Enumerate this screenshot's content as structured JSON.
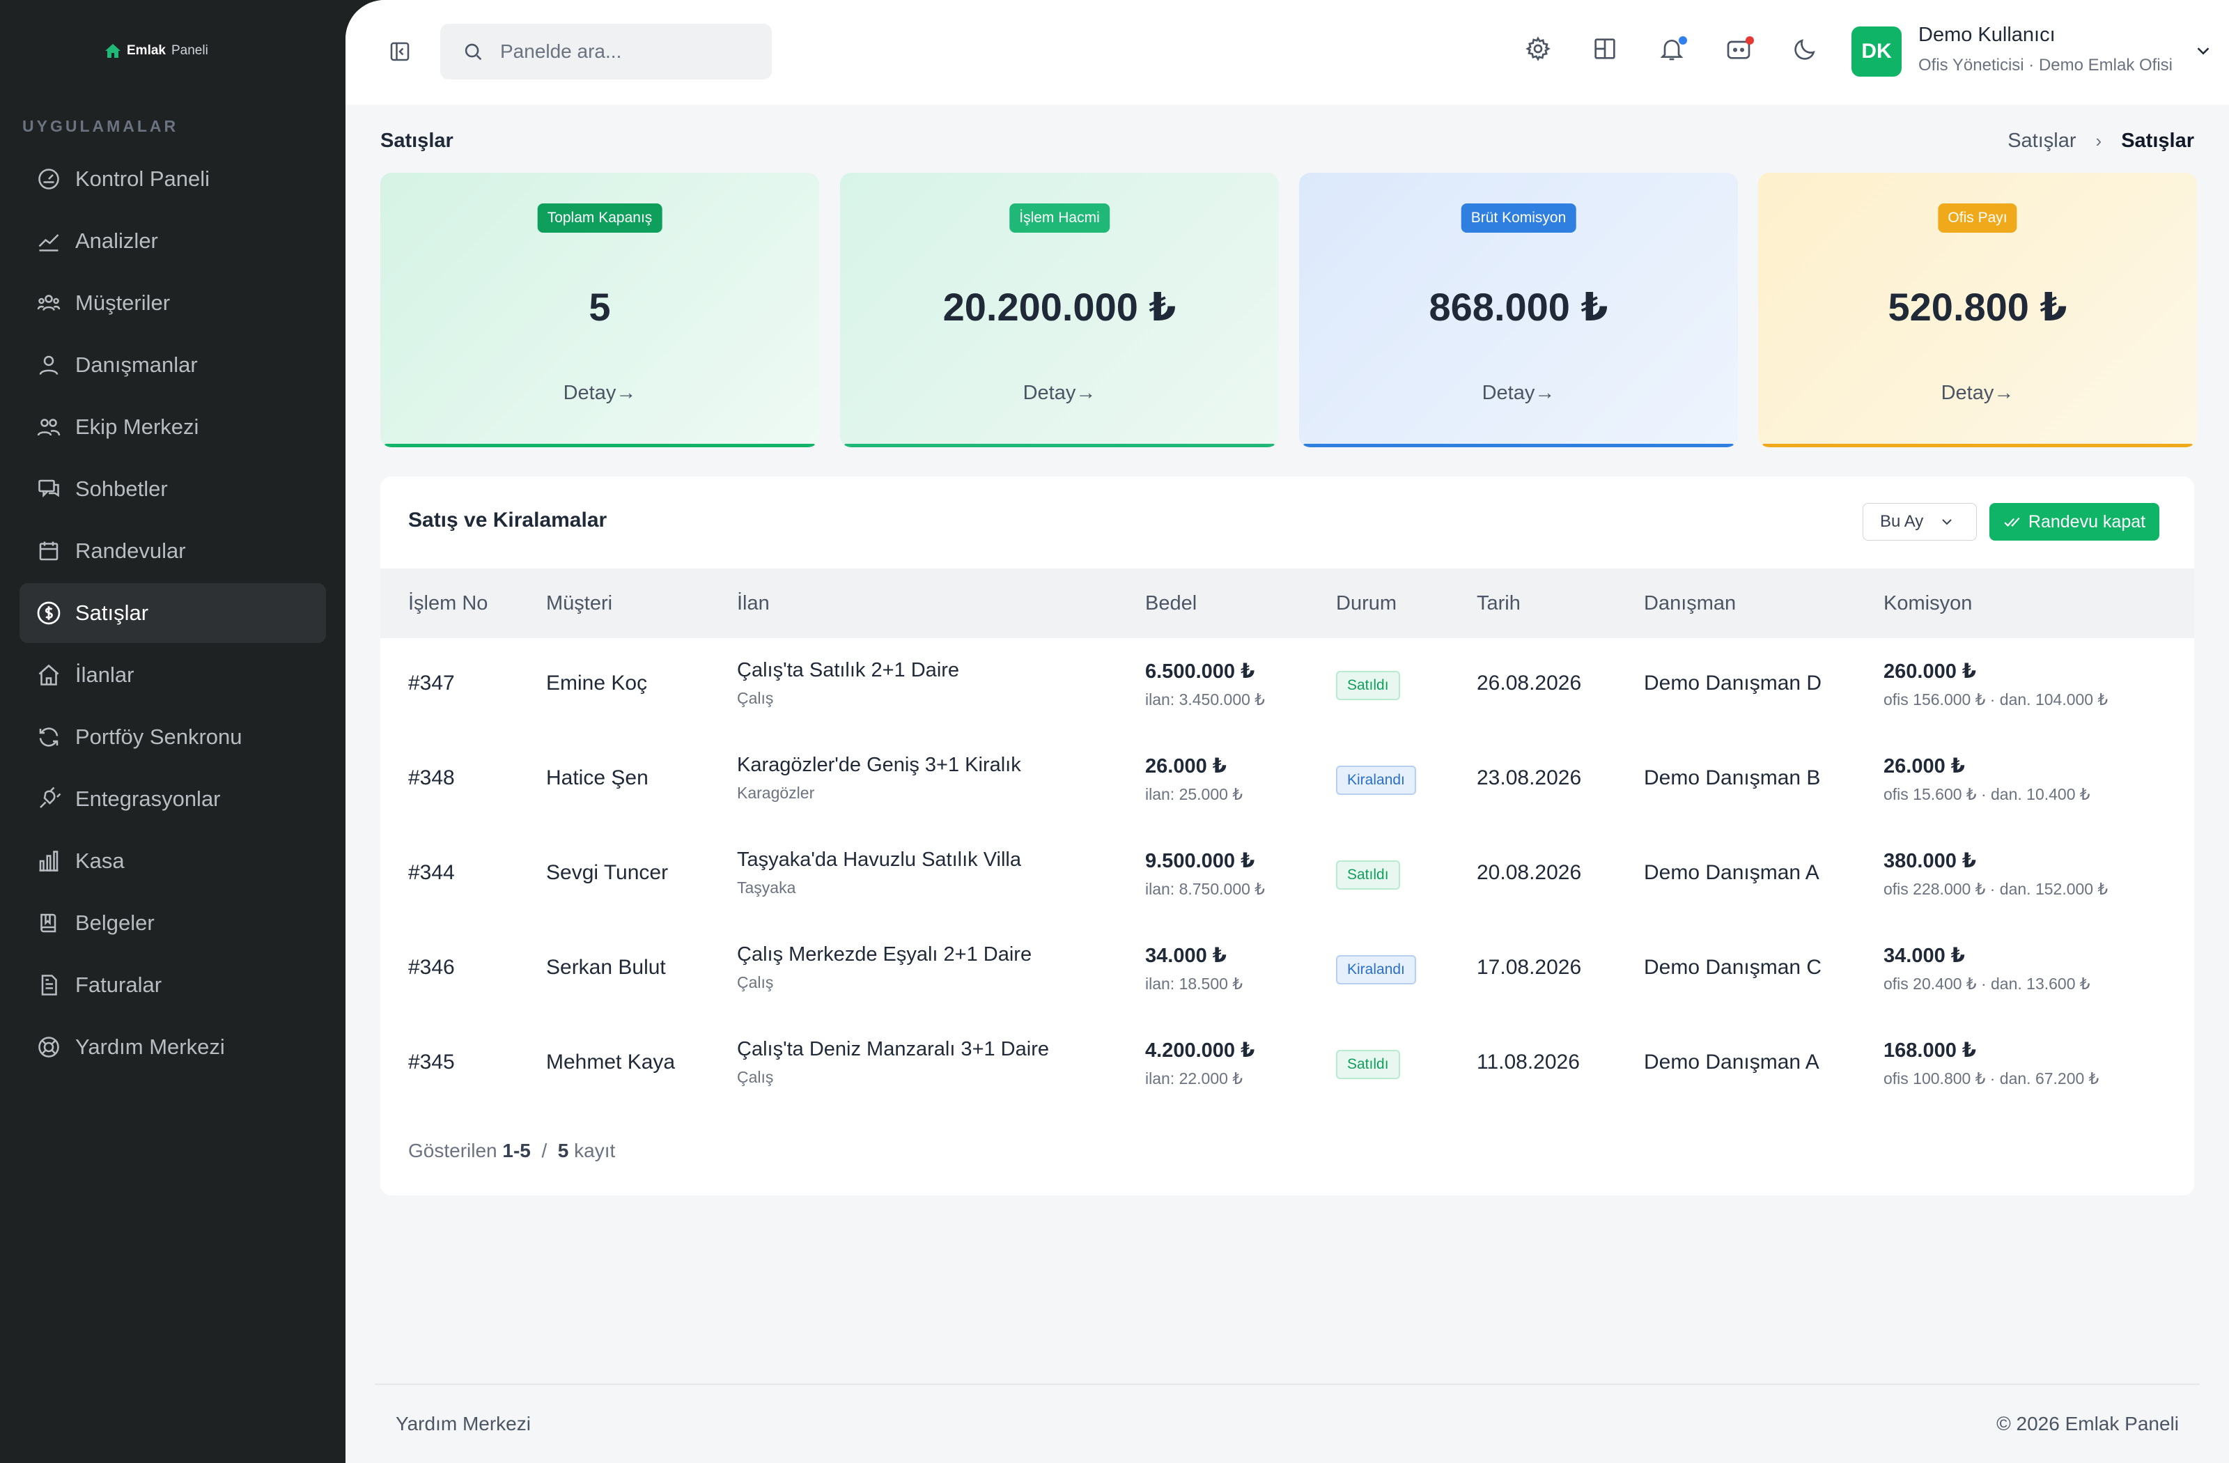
{
  "brand": {
    "name": "Emlak",
    "suffix": "Paneli"
  },
  "sidebar": {
    "section_title": "UYGULAMALAR",
    "items": [
      {
        "label": "Kontrol Paneli",
        "icon": "dashboard-icon"
      },
      {
        "label": "Analizler",
        "icon": "chart-line-icon"
      },
      {
        "label": "Müşteriler",
        "icon": "users-icon"
      },
      {
        "label": "Danışmanlar",
        "icon": "user-icon"
      },
      {
        "label": "Ekip Merkezi",
        "icon": "team-icon"
      },
      {
        "label": "Sohbetler",
        "icon": "chat-icon"
      },
      {
        "label": "Randevular",
        "icon": "calendar-icon"
      },
      {
        "label": "Satışlar",
        "icon": "dollar-icon",
        "active": true
      },
      {
        "label": "İlanlar",
        "icon": "home-icon"
      },
      {
        "label": "Portföy Senkronu",
        "icon": "sync-icon"
      },
      {
        "label": "Entegrasyonlar",
        "icon": "plug-icon"
      },
      {
        "label": "Kasa",
        "icon": "bar-chart-icon"
      },
      {
        "label": "Belgeler",
        "icon": "book-icon"
      },
      {
        "label": "Faturalar",
        "icon": "invoice-icon"
      },
      {
        "label": "Yardım Merkezi",
        "icon": "help-icon"
      }
    ]
  },
  "topbar": {
    "search_placeholder": "Panelde ara...",
    "user": {
      "initials": "DK",
      "name": "Demo Kullanıcı",
      "role": "Ofis Yöneticisi · Demo Emlak Ofisi"
    },
    "notification_dot_color": "#2f80ed",
    "message_dot_color": "#e53935"
  },
  "page": {
    "title": "Satışlar",
    "breadcrumb": {
      "parent": "Satışlar",
      "separator": "›",
      "current": "Satışlar"
    }
  },
  "stats": [
    {
      "badge": "Toplam Kapanış",
      "value": "5",
      "detail": "Detay→",
      "color": "#0f9f5c"
    },
    {
      "badge": "İşlem Hacmi",
      "value": "20.200.000 ₺",
      "detail": "Detay→",
      "color": "#1fb877"
    },
    {
      "badge": "Brüt Komisyon",
      "value": "868.000 ₺",
      "detail": "Detay→",
      "color": "#2f7fe0"
    },
    {
      "badge": "Ofis Payı",
      "value": "520.800 ₺",
      "detail": "Detay→",
      "color": "#f0a91b"
    }
  ],
  "table": {
    "title": "Satış ve Kiralamalar",
    "period": "Bu Ay",
    "action_button": "Randevu kapat",
    "columns": [
      "İşlem No",
      "Müşteri",
      "İlan",
      "Bedel",
      "Durum",
      "Tarih",
      "Danışman",
      "Komisyon"
    ],
    "rows": [
      {
        "id": "#347",
        "customer": "Emine Koç",
        "listing": "Çalış'ta Satılık 2+1 Daire",
        "location": "Çalış",
        "price": "6.500.000 ₺",
        "listed": "ilan: 3.450.000 ₺",
        "status": "Satıldı",
        "status_type": "sold",
        "date": "26.08.2026",
        "agent": "Demo Danışman D",
        "commission": "260.000 ₺",
        "split": "ofis 156.000 ₺ · dan. 104.000 ₺"
      },
      {
        "id": "#348",
        "customer": "Hatice Şen",
        "listing": "Karagözler'de Geniş 3+1 Kiralık",
        "location": "Karagözler",
        "price": "26.000 ₺",
        "listed": "ilan: 25.000 ₺",
        "status": "Kiralandı",
        "status_type": "rent",
        "date": "23.08.2026",
        "agent": "Demo Danışman B",
        "commission": "26.000 ₺",
        "split": "ofis 15.600 ₺ · dan. 10.400 ₺"
      },
      {
        "id": "#344",
        "customer": "Sevgi Tuncer",
        "listing": "Taşyaka'da Havuzlu Satılık Villa",
        "location": "Taşyaka",
        "price": "9.500.000 ₺",
        "listed": "ilan: 8.750.000 ₺",
        "status": "Satıldı",
        "status_type": "sold",
        "date": "20.08.2026",
        "agent": "Demo Danışman A",
        "commission": "380.000 ₺",
        "split": "ofis 228.000 ₺ · dan. 152.000 ₺"
      },
      {
        "id": "#346",
        "customer": "Serkan Bulut",
        "listing": "Çalış Merkezde Eşyalı 2+1 Daire",
        "location": "Çalış",
        "price": "34.000 ₺",
        "listed": "ilan: 18.500 ₺",
        "status": "Kiralandı",
        "status_type": "rent",
        "date": "17.08.2026",
        "agent": "Demo Danışman C",
        "commission": "34.000 ₺",
        "split": "ofis 20.400 ₺ · dan. 13.600 ₺"
      },
      {
        "id": "#345",
        "customer": "Mehmet Kaya",
        "listing": "Çalış'ta Deniz Manzaralı 3+1 Daire",
        "location": "Çalış",
        "price": "4.200.000 ₺",
        "listed": "ilan: 22.000 ₺",
        "status": "Satıldı",
        "status_type": "sold",
        "date": "11.08.2026",
        "agent": "Demo Danışman A",
        "commission": "168.000 ₺",
        "split": "ofis 100.800 ₺ · dan. 67.200 ₺"
      }
    ],
    "pager": {
      "prefix": "Gösterilen",
      "range": "1-5",
      "separator": "/",
      "total": "5",
      "suffix": "kayıt"
    }
  },
  "footer": {
    "left": "Yardım Merkezi",
    "right": "© 2026 Emlak Paneli"
  }
}
